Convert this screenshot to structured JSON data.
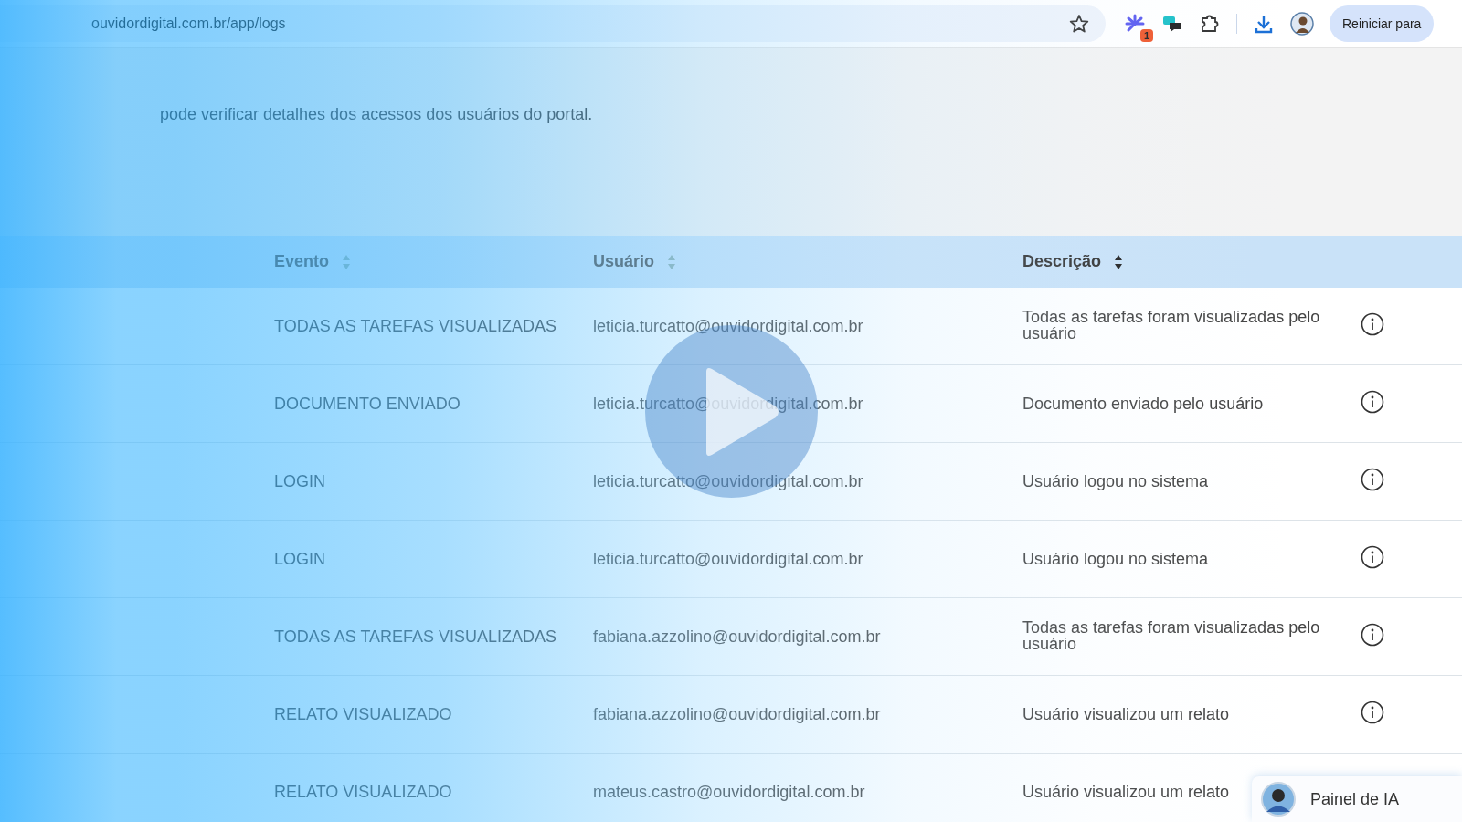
{
  "browser": {
    "url": "ouvidordigital.com.br/app/logs",
    "extension_badge": "1",
    "restart_button": "Reiniciar para"
  },
  "page": {
    "subtitle": "pode verificar detalhes dos acessos dos usuários do portal."
  },
  "table": {
    "columns": [
      {
        "label": "Evento",
        "sort_active": false
      },
      {
        "label": "Usuário",
        "sort_active": false
      },
      {
        "label": "Descrição",
        "sort_active": true
      }
    ],
    "rows": [
      {
        "event": "TODAS AS TAREFAS VISUALIZADAS",
        "user": "leticia.turcatto@ouvidordigital.com.br",
        "description": "Todas as tarefas foram visualizadas pelo usuário"
      },
      {
        "event": "DOCUMENTO ENVIADO",
        "user": "leticia.turcatto@ouvidordigital.com.br",
        "description": "Documento enviado pelo usuário"
      },
      {
        "event": "LOGIN",
        "user": "leticia.turcatto@ouvidordigital.com.br",
        "description": "Usuário logou no sistema"
      },
      {
        "event": "LOGIN",
        "user": "leticia.turcatto@ouvidordigital.com.br",
        "description": "Usuário logou no sistema"
      },
      {
        "event": "TODAS AS TAREFAS VISUALIZADAS",
        "user": "fabiana.azzolino@ouvidordigital.com.br",
        "description": "Todas as tarefas foram visualizadas pelo usuário"
      },
      {
        "event": "RELATO VISUALIZADO",
        "user": "fabiana.azzolino@ouvidordigital.com.br",
        "description": "Usuário visualizou um relato"
      },
      {
        "event": "RELATO VISUALIZADO",
        "user": "mateus.castro@ouvidordigital.com.br",
        "description": "Usuário visualizou um relato",
        "info_hidden": true
      }
    ]
  },
  "ai_panel": {
    "label": "Painel de IA"
  }
}
